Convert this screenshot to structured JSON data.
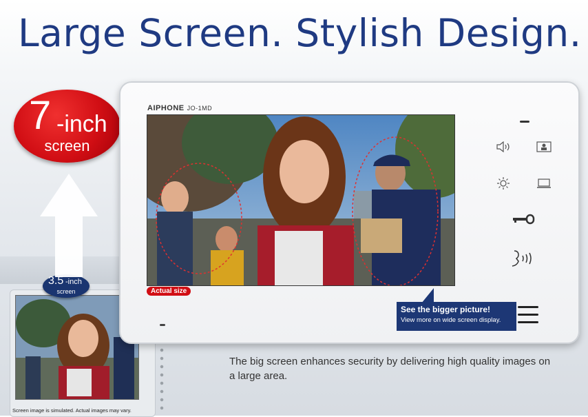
{
  "headline": "Large Screen. Stylish Design.",
  "badge_large": {
    "number": "7",
    "unit": "-inch",
    "word": "screen"
  },
  "badge_small": {
    "number": "3.5",
    "unit": "-inch",
    "word": "screen"
  },
  "device": {
    "brand": "AIPHONE",
    "model": "JO-1MD"
  },
  "actual_size_tag": "Actual size",
  "callout": {
    "title": "See the bigger picture!",
    "subtitle": "View more on wide screen display."
  },
  "description": "The big screen enhances security by delivering high quality images on a large area.",
  "disclaimer": "Screen image is simulated. Actual images may vary.",
  "controls": {
    "volume": "volume-icon",
    "monitor": "monitor-icon",
    "brightness": "brightness-icon",
    "screen_off": "screen-icon",
    "door_release": "key-icon",
    "talk": "talk-icon"
  },
  "colors": {
    "headline": "#1f3a82",
    "badge_red": "#d10e14",
    "callout_navy": "#1d3775"
  }
}
